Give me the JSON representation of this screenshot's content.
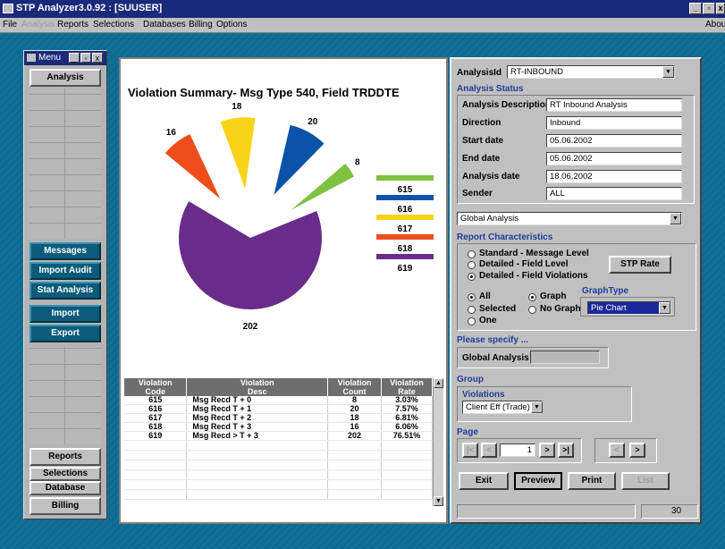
{
  "window": {
    "title": "STP Analyzer3.0.92 :  [SUUSER]",
    "about_label": "Abou"
  },
  "menubar": [
    "File",
    "Analysis",
    "Reports",
    "Selections",
    "Databases",
    "Billing",
    "Options"
  ],
  "menu_panel": {
    "title": "Menu",
    "top_button": "Analysis",
    "middle_buttons": [
      "Messages",
      "Import Audit",
      "Stat Analysis",
      "Import",
      "Export"
    ],
    "bottom_buttons": [
      "Reports",
      "Selections",
      "Database",
      "Billing"
    ]
  },
  "chart_data": {
    "type": "pie",
    "title": "Violation Summary- Msg Type 540, Field TRDDTE",
    "slices": [
      {
        "label": "615",
        "value": 8,
        "color": "#7fc242"
      },
      {
        "label": "616",
        "value": 20,
        "color": "#0a53a8"
      },
      {
        "label": "617",
        "value": 18,
        "color": "#f7d417"
      },
      {
        "label": "618",
        "value": 16,
        "color": "#ee4e1c"
      },
      {
        "label": "619",
        "value": 202,
        "color": "#6a2c8a"
      }
    ],
    "legend": [
      "615",
      "616",
      "617",
      "618",
      "619"
    ],
    "legend_placement": "right"
  },
  "table": {
    "headers_top": [
      "Violation",
      "Violation",
      "Violation",
      "Violation"
    ],
    "headers_bottom": [
      "Code",
      "Desc",
      "Count",
      "Rate"
    ],
    "rows": [
      [
        "615",
        "Msg Recd T + 0",
        "8",
        "3.03%"
      ],
      [
        "616",
        "Msg Recd T + 1",
        "20",
        "7.57%"
      ],
      [
        "617",
        "Msg Recd T + 2",
        "18",
        "6.81%"
      ],
      [
        "618",
        "Msg Recd T + 3",
        "16",
        "6.06%"
      ],
      [
        "619",
        "Msg Recd > T + 3",
        "202",
        "76.51%"
      ]
    ]
  },
  "right_panel": {
    "analysis_id_label": "AnalysisId",
    "analysis_id_value": "RT-INBOUND",
    "analysis_status_label": "Analysis Status",
    "status_fields": [
      {
        "label": "Analysis Description",
        "value": "RT Inbound Analysis"
      },
      {
        "label": "Direction",
        "value": "Inbound"
      },
      {
        "label": "Start date",
        "value": "05.06.2002"
      },
      {
        "label": "End date",
        "value": "05.06.2002"
      },
      {
        "label": "Analysis date",
        "value": "18.06.2002"
      },
      {
        "label": "Sender",
        "value": "ALL"
      }
    ],
    "analysis_type_value": "Global Analysis",
    "report_characteristics_label": "Report Characteristics",
    "report_options": [
      "Standard - Message Level",
      "Detailed - Field Level",
      "Detailed - Field Violations"
    ],
    "report_selected": 2,
    "stp_rate_button": "STP Rate",
    "scope_options": [
      "All",
      "Selected",
      "One"
    ],
    "scope_selected": 0,
    "graph_options": [
      "Graph",
      "No Graph"
    ],
    "graph_selected": 0,
    "graph_type_label": "GraphType",
    "graph_type_value": "Pie Chart",
    "please_specify_label": "Please specify ...",
    "global_analysis_label": "Global Analysis",
    "group_label": "Group",
    "violations_label": "Violations",
    "violations_value": "Client Eff (Trade)",
    "page_label": "Page",
    "page_value": "1",
    "nav_buttons": [
      "|<",
      "<",
      ">",
      ">|"
    ],
    "nav2_buttons": [
      "<",
      ">"
    ],
    "action_buttons": [
      "Exit",
      "Preview",
      "Print",
      "List"
    ],
    "status_count": "30"
  }
}
